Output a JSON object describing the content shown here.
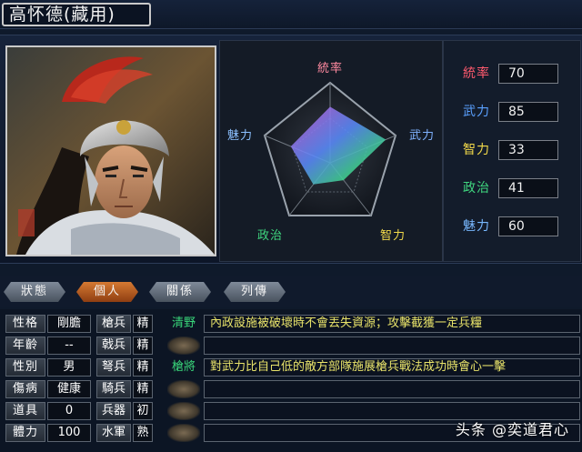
{
  "title": "高怀德(藏用)",
  "radar": {
    "labels": {
      "tong": "統率",
      "wu": "武力",
      "zhi": "智力",
      "zheng": "政治",
      "mei": "魅力"
    },
    "colors": {
      "tong": "#ff6b8a",
      "wu": "#6fa8ff",
      "zhi": "#f2d94a",
      "zheng": "#3fd67f",
      "mei": "#78b8ff"
    }
  },
  "stats": [
    {
      "label": "統率",
      "value": "70",
      "color": "#ff5a6e"
    },
    {
      "label": "武力",
      "value": "85",
      "color": "#5aa0ff"
    },
    {
      "label": "智力",
      "value": "33",
      "color": "#f2d94a"
    },
    {
      "label": "政治",
      "value": "41",
      "color": "#3fd67f"
    },
    {
      "label": "魅力",
      "value": "60",
      "color": "#78b8ff"
    }
  ],
  "tabs": [
    "狀態",
    "個人",
    "關係",
    "列傳"
  ],
  "active_tab": "個人",
  "profile": [
    {
      "label": "性格",
      "value": "剛膽"
    },
    {
      "label": "年齡",
      "value": "--"
    },
    {
      "label": "性別",
      "value": "男"
    },
    {
      "label": "傷病",
      "value": "健康"
    },
    {
      "label": "道具",
      "value": "0"
    },
    {
      "label": "體力",
      "value": "100"
    }
  ],
  "troops": [
    {
      "label": "槍兵",
      "grade": "精"
    },
    {
      "label": "戟兵",
      "grade": "精"
    },
    {
      "label": "弩兵",
      "grade": "精"
    },
    {
      "label": "騎兵",
      "grade": "精"
    },
    {
      "label": "兵器",
      "grade": "初"
    },
    {
      "label": "水軍",
      "grade": "熟"
    }
  ],
  "skills": [
    {
      "name": "清野",
      "desc": "內政設施被破壞時不會丟失資源；攻擊截獲一定兵糧"
    },
    {
      "name": "",
      "desc": ""
    },
    {
      "name": "槍將",
      "desc": "對武力比自己低的敵方部隊施展槍兵戰法成功時會心一擊"
    },
    {
      "name": "",
      "desc": ""
    },
    {
      "name": "",
      "desc": ""
    },
    {
      "name": "",
      "desc": ""
    }
  ],
  "watermark": "头条 @奕道君心"
}
